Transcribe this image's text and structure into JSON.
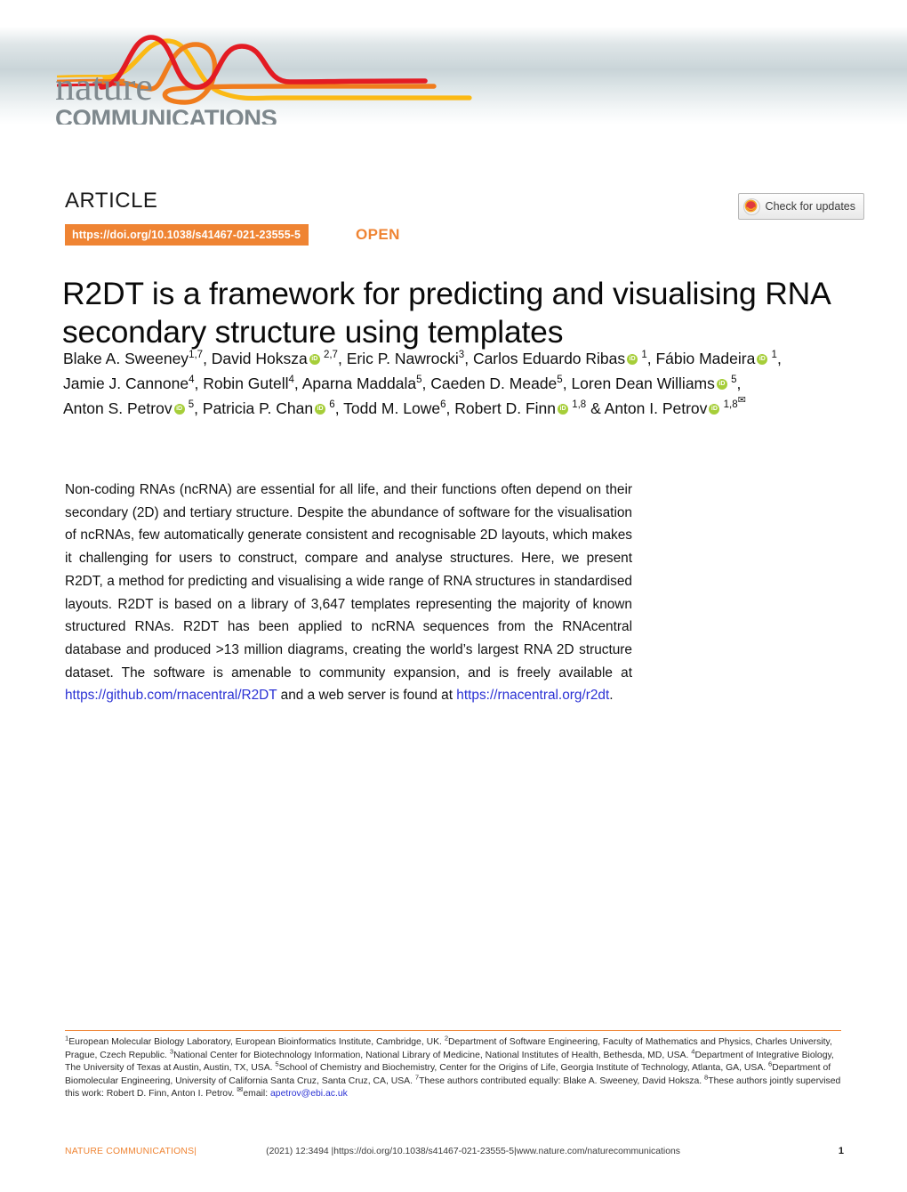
{
  "masthead": {
    "logo_nature": "nature",
    "logo_communications": "COMMUNICATIONS",
    "wave_colors": [
      "#e31b23",
      "#f07c1d",
      "#fbb914"
    ],
    "band_color": "#c9d4d8"
  },
  "header": {
    "article_label": "ARTICLE",
    "doi_badge": "https://doi.org/10.1038/s41467-021-23555-5",
    "doi_badge_color": "#ef8433",
    "open_label": "OPEN",
    "open_color": "#ef8433",
    "check_updates_label": "Check for updates"
  },
  "title": "R2DT is a framework for predicting and visualising RNA secondary structure using templates",
  "authors": {
    "line1": [
      {
        "name": "Blake A. Sweeney",
        "orcid": false,
        "sup": "1,7",
        "sep": ", "
      },
      {
        "name": "David Hoksza",
        "orcid": true,
        "sup": "2,7",
        "sep": ", "
      },
      {
        "name": "Eric P. Nawrocki",
        "orcid": false,
        "sup": "3",
        "sep": ", "
      },
      {
        "name": "Carlos Eduardo Ribas",
        "orcid": true,
        "sup": "1",
        "sep": ", "
      },
      {
        "name": "Fábio Madeira",
        "orcid": true,
        "sup": "1",
        "sep": ","
      }
    ],
    "line2": [
      {
        "name": "Jamie J. Cannone",
        "orcid": false,
        "sup": "4",
        "sep": ", "
      },
      {
        "name": "Robin Gutell",
        "orcid": false,
        "sup": "4",
        "sep": ", "
      },
      {
        "name": "Aparna Maddala",
        "orcid": false,
        "sup": "5",
        "sep": ", "
      },
      {
        "name": "Caeden D. Meade",
        "orcid": false,
        "sup": "5",
        "sep": ", "
      },
      {
        "name": "Loren Dean Williams",
        "orcid": true,
        "sup": "5",
        "sep": ","
      }
    ],
    "line3": [
      {
        "name": "Anton S. Petrov",
        "orcid": true,
        "sup": "5",
        "sep": ", "
      },
      {
        "name": "Patricia P. Chan",
        "orcid": true,
        "sup": "6",
        "sep": ", "
      },
      {
        "name": "Todd M. Lowe",
        "orcid": false,
        "sup": "6",
        "sep": ", "
      },
      {
        "name": "Robert D. Finn",
        "orcid": true,
        "sup": "1,8",
        "sep": " & "
      },
      {
        "name": "Anton I. Petrov",
        "orcid": true,
        "sup": "1,8",
        "sep": "",
        "email_marker": true
      }
    ]
  },
  "abstract": {
    "part1": "Non-coding RNAs (ncRNA) are essential for all life, and their functions often depend on their secondary (2D) and tertiary structure. Despite the abundance of software for the visualisation of ncRNAs, few automatically generate consistent and recognisable 2D layouts, which makes it challenging for users to construct, compare and analyse structures. Here, we present R2DT, a method for predicting and visualising a wide range of RNA structures in standardised layouts. R2DT is based on a library of 3,647 templates representing the majority of known structured RNAs. R2DT has been applied to ncRNA sequences from the RNAcentral database and produced >13 million diagrams, creating the world’s largest RNA 2D structure dataset. The software is amenable to community expansion, and is freely available at ",
    "link1": "https://github.com/rnacentral/R2DT",
    "part2": " and a web server is found at ",
    "link2": "https://rnacentral.org/r2dt",
    "part3": "."
  },
  "affiliations": {
    "items": [
      {
        "sup": "1",
        "text": "European Molecular Biology Laboratory, European Bioinformatics Institute, Cambridge, UK."
      },
      {
        "sup": "2",
        "text": "Department of Software Engineering, Faculty of Mathematics and Physics, Charles University, Prague, Czech Republic."
      },
      {
        "sup": "3",
        "text": "National Center for Biotechnology Information, National Library of Medicine, National Institutes of Health, Bethesda, MD, USA."
      },
      {
        "sup": "4",
        "text": "Department of Integrative Biology, The University of Texas at Austin, Austin, TX, USA."
      },
      {
        "sup": "5",
        "text": "School of Chemistry and Biochemistry, Center for the Origins of Life, Georgia Institute of Technology, Atlanta, GA, USA."
      },
      {
        "sup": "6",
        "text": "Department of Biomolecular Engineering, University of California Santa Cruz, Santa Cruz, CA, USA."
      },
      {
        "sup": "7",
        "text": "These authors contributed equally: Blake A. Sweeney, David Hoksza."
      },
      {
        "sup": "8",
        "text": "These authors jointly supervised this work: Robert D. Finn, Anton I. Petrov."
      }
    ],
    "email_label": "email:",
    "email": "apetrov@ebi.ac.uk"
  },
  "footer": {
    "brand": "NATURE COMMUNICATIONS",
    "brand_sep": "|",
    "citation": "(2021) 12:3494",
    "citation_sep": "|",
    "doi": "https://doi.org/10.1038/s41467-021-23555-5",
    "doi_sep": "|",
    "site": "www.nature.com/naturecommunications",
    "page": "1"
  }
}
